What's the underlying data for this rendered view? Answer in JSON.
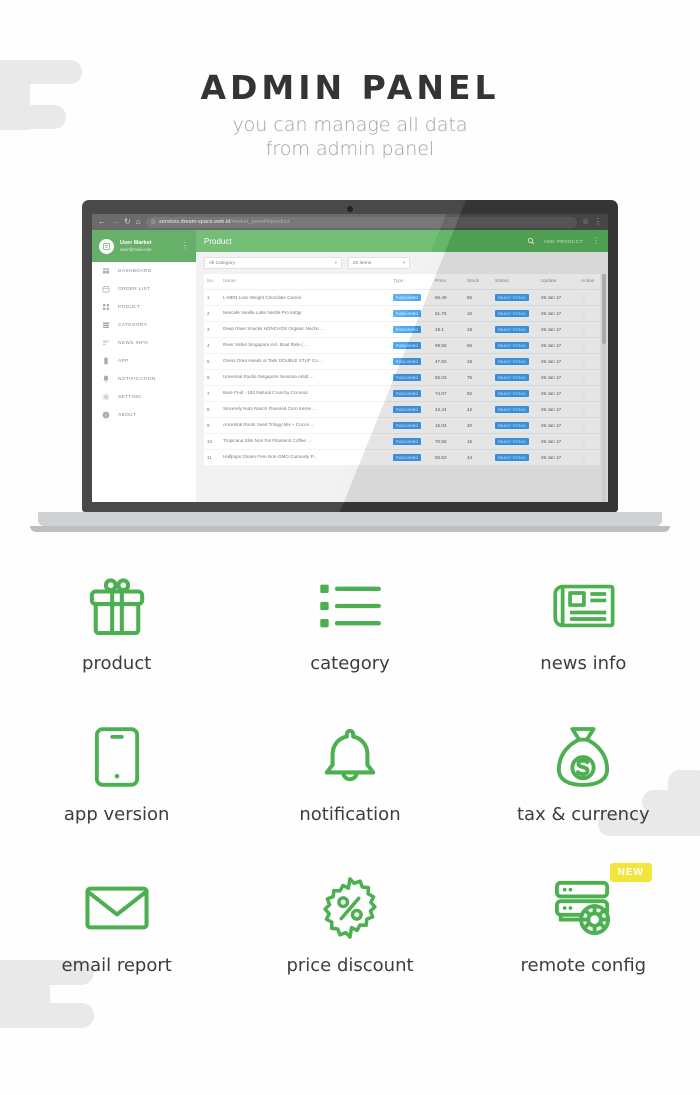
{
  "hero": {
    "title": "ADMIN PANEL",
    "subtitle_line1": "you can manage all data",
    "subtitle_line2": "from admin panel"
  },
  "browser": {
    "back_icon": "back-arrow-icon",
    "forward_icon": "forward-arrow-icon",
    "reload_icon": "reload-icon",
    "home_icon": "home-icon",
    "lock_icon": "lock-icon",
    "url_domain": "services.dream-space.web.id",
    "url_path": "/market_panel/#/product",
    "star_icon": "star-icon",
    "menu_icon": "kebab-menu-icon"
  },
  "admin": {
    "profile": {
      "name": "User Market",
      "email": "user@mail.com",
      "avatar_icon": "user-avatar-icon",
      "menu_icon": "kebab-menu-icon"
    },
    "nav": [
      {
        "label": "DASHBOARD",
        "icon": "dashboard-icon"
      },
      {
        "label": "ORDER LIST",
        "icon": "calendar-icon"
      },
      {
        "label": "PODUCT",
        "icon": "grid-icon"
      },
      {
        "label": "CATEGORY",
        "icon": "list-icon"
      },
      {
        "label": "NEWS INFO",
        "icon": "news-icon"
      },
      {
        "label": "APP",
        "icon": "phone-icon"
      },
      {
        "label": "NOTIFICATION",
        "icon": "bell-icon"
      },
      {
        "label": "SETTING",
        "icon": "gear-icon"
      },
      {
        "label": "ABOUT",
        "icon": "info-icon"
      }
    ],
    "appbar": {
      "title": "Product",
      "search_icon": "search-icon",
      "add_label": "ADD PRODUCT",
      "menu_icon": "kebab-menu-icon"
    },
    "filters": {
      "category": "All Category",
      "items": "20 items"
    },
    "table": {
      "headers": [
        "No",
        "Name",
        "Type",
        "Price",
        "Stock",
        "Status",
        "Update",
        "Action"
      ],
      "rows": [
        {
          "no": "1",
          "name": "L-MEN Lose Weight Chocolate Cereal",
          "type": "PUBLISHED",
          "price": "66.49",
          "stock": "85",
          "status": "READY STOCK",
          "update": "29 Jan 17"
        },
        {
          "no": "2",
          "name": "Nescafe Vanilla Latte Nestle Pro 640gr",
          "type": "PUBLISHED",
          "price": "61.76",
          "stock": "10",
          "status": "READY STOCK",
          "update": "29 Jan 17"
        },
        {
          "no": "3",
          "name": "Deep River Snacks HONCHOS Organic Nacho ...",
          "type": "PUBLISHED",
          "price": "19.1",
          "stock": "18",
          "status": "READY STOCK",
          "update": "29 Jan 17"
        },
        {
          "no": "4",
          "name": "River Safari Singapore incl. Boat Ride ( ...",
          "type": "PUBLISHED",
          "price": "69.58",
          "stock": "56",
          "status": "READY STOCK",
          "update": "29 Jan 17"
        },
        {
          "no": "5",
          "name": "Oreos Oreo Heads or Tails DOUBLE STUF Co ...",
          "type": "PUBLISHED",
          "price": "47.93",
          "stock": "18",
          "status": "READY STOCK",
          "update": "29 Jan 17"
        },
        {
          "no": "6",
          "name": "Universal Studio Singapore Sentosa Adult ...",
          "type": "PUBLISHED",
          "price": "55.03",
          "stock": "75",
          "status": "READY STOCK",
          "update": "29 Jan 17"
        },
        {
          "no": "7",
          "name": "Bare Fruit - 100 Natural Crunchy Coconut",
          "type": "PUBLISHED",
          "price": "74.07",
          "stock": "82",
          "status": "READY STOCK",
          "update": "29 Jan 17"
        },
        {
          "no": "8",
          "name": "Sincerely Nuts Ranch Flavored Corn Kerne ...",
          "type": "PUBLISHED",
          "price": "43.44",
          "stock": "42",
          "status": "READY STOCK",
          "update": "29 Jan 17"
        },
        {
          "no": "9",
          "name": "Ancestral Roots Seed Trilogy Mix + Cocon ...",
          "type": "PUBLISHED",
          "price": "16.04",
          "stock": "40",
          "status": "READY STOCK",
          "update": "29 Jan 17"
        },
        {
          "no": "10",
          "name": "Tropicana Slim Non Fat Fitosterol Coffee ...",
          "type": "PUBLISHED",
          "price": "70.58",
          "stock": "16",
          "status": "READY STOCK",
          "update": "29 Jan 17"
        },
        {
          "no": "11",
          "name": "Halfpops Gluten Free Non-GMO Curiously P...",
          "type": "PUBLISHED",
          "price": "50.63",
          "stock": "44",
          "status": "READY STOCK",
          "update": "29 Jan 17"
        }
      ],
      "row_action_icon": "kebab-menu-icon"
    }
  },
  "features": [
    {
      "label": "product",
      "icon": "gift-icon"
    },
    {
      "label": "category",
      "icon": "bullet-list-icon"
    },
    {
      "label": "news info",
      "icon": "newspaper-icon"
    },
    {
      "label": "app version",
      "icon": "mobile-phone-icon"
    },
    {
      "label": "notification",
      "icon": "bell-icon"
    },
    {
      "label": "tax & currency",
      "icon": "money-bag-icon"
    },
    {
      "label": "email report",
      "icon": "envelope-icon"
    },
    {
      "label": "price discount",
      "icon": "percent-badge-icon"
    },
    {
      "label": "remote config",
      "icon": "server-gear-icon",
      "badge": "NEW"
    }
  ],
  "colors": {
    "brand_green": "#49a04c",
    "appbar_green": "#58b15c",
    "chip_blue": "#3fa0f0",
    "badge_yellow": "#f2e53c",
    "decor_gray": "#e9e9e9",
    "laptop_body": "#3b3b3b",
    "laptop_base": "#cfd1d3"
  }
}
